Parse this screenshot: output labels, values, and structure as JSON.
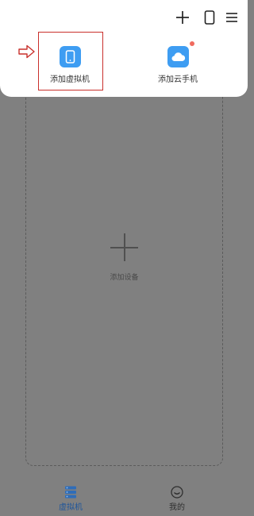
{
  "popup": {
    "top_actions": [
      {
        "icon": "plus-icon"
      },
      {
        "icon": "phone-outline-icon"
      },
      {
        "icon": "hamburger-menu-icon"
      }
    ],
    "options": [
      {
        "label": "添加虚拟机",
        "icon": "phone-icon",
        "highlighted": true
      },
      {
        "label": "添加云手机",
        "icon": "cloud-icon",
        "badge": "red-dot"
      }
    ]
  },
  "main": {
    "add_device_label": "添加设备"
  },
  "bottom_nav": {
    "items": [
      {
        "label": "虚拟机",
        "icon": "vm-stack-icon",
        "active": true
      },
      {
        "label": "我的",
        "icon": "smile-face-icon",
        "active": false
      }
    ]
  },
  "colors": {
    "accent": "#3e9df2",
    "highlight": "#c9302c",
    "badge": "#f06a5e",
    "overlay": "#808080",
    "active_nav": "#20569a"
  }
}
